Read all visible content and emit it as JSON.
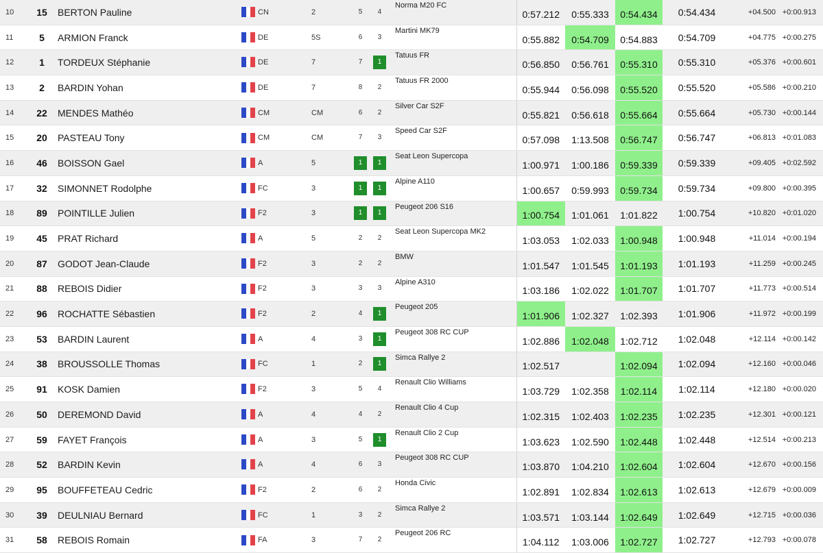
{
  "results": {
    "rows": [
      {
        "pos": "10",
        "num": "15",
        "name": "BERTON Pauline",
        "cls": "CN",
        "grp": "2",
        "rk1": "5",
        "rk2": "4",
        "rk2_top": false,
        "car": "Norma M20 FC",
        "t1": "0:57.212",
        "t2": "0:55.333",
        "t3": "0:54.434",
        "best_col": 3,
        "best": "0:54.434",
        "gap": "+04.500",
        "diff": "+0:00.913"
      },
      {
        "pos": "11",
        "num": "5",
        "name": "ARMION Franck",
        "cls": "DE",
        "grp": "5S",
        "rk1": "6",
        "rk2": "3",
        "rk2_top": false,
        "car": "Martini MK79",
        "t1": "0:55.882",
        "t2": "0:54.709",
        "t3": "0:54.883",
        "best_col": 2,
        "best": "0:54.709",
        "gap": "+04.775",
        "diff": "+0:00.275"
      },
      {
        "pos": "12",
        "num": "1",
        "name": "TORDEUX Stéphanie",
        "cls": "DE",
        "grp": "7",
        "rk1": "7",
        "rk2": "1",
        "rk2_top": true,
        "car": "Tatuus FR",
        "t1": "0:56.850",
        "t2": "0:56.761",
        "t3": "0:55.310",
        "best_col": 3,
        "best": "0:55.310",
        "gap": "+05.376",
        "diff": "+0:00.601"
      },
      {
        "pos": "13",
        "num": "2",
        "name": "BARDIN Yohan",
        "cls": "DE",
        "grp": "7",
        "rk1": "8",
        "rk2": "2",
        "rk2_top": false,
        "car": "Tatuus FR 2000",
        "t1": "0:55.944",
        "t2": "0:56.098",
        "t3": "0:55.520",
        "best_col": 3,
        "best": "0:55.520",
        "gap": "+05.586",
        "diff": "+0:00.210"
      },
      {
        "pos": "14",
        "num": "22",
        "name": "MENDES Mathéo",
        "cls": "CM",
        "grp": "CM",
        "rk1": "6",
        "rk2": "2",
        "rk2_top": false,
        "car": "Silver Car S2F",
        "t1": "0:55.821",
        "t2": "0:56.618",
        "t3": "0:55.664",
        "best_col": 3,
        "best": "0:55.664",
        "gap": "+05.730",
        "diff": "+0:00.144"
      },
      {
        "pos": "15",
        "num": "20",
        "name": "PASTEAU Tony",
        "cls": "CM",
        "grp": "CM",
        "rk1": "7",
        "rk2": "3",
        "rk2_top": false,
        "car": "Speed Car S2F",
        "t1": "0:57.098",
        "t2": "1:13.508",
        "t3": "0:56.747",
        "best_col": 3,
        "best": "0:56.747",
        "gap": "+06.813",
        "diff": "+0:01.083"
      },
      {
        "pos": "16",
        "num": "46",
        "name": "BOISSON Gael",
        "cls": "A",
        "grp": "5",
        "rk1": "1",
        "rk2": "1",
        "rk1_top": true,
        "rk2_top": true,
        "car": "Seat Leon Supercopa",
        "t1": "1:00.971",
        "t2": "1:00.186",
        "t3": "0:59.339",
        "best_col": 3,
        "best": "0:59.339",
        "gap": "+09.405",
        "diff": "+0:02.592"
      },
      {
        "pos": "17",
        "num": "32",
        "name": "SIMONNET Rodolphe",
        "cls": "FC",
        "grp": "3",
        "rk1": "1",
        "rk2": "1",
        "rk1_top": true,
        "rk2_top": true,
        "car": "Alpine A110",
        "t1": "1:00.657",
        "t2": "0:59.993",
        "t3": "0:59.734",
        "best_col": 3,
        "best": "0:59.734",
        "gap": "+09.800",
        "diff": "+0:00.395"
      },
      {
        "pos": "18",
        "num": "89",
        "name": "POINTILLE Julien",
        "cls": "F2",
        "grp": "3",
        "rk1": "1",
        "rk2": "1",
        "rk1_top": true,
        "rk2_top": true,
        "car": "Peugeot 206 S16",
        "t1": "1:00.754",
        "t2": "1:01.061",
        "t3": "1:01.822",
        "best_col": 1,
        "best": "1:00.754",
        "gap": "+10.820",
        "diff": "+0:01.020"
      },
      {
        "pos": "19",
        "num": "45",
        "name": "PRAT Richard",
        "cls": "A",
        "grp": "5",
        "rk1": "2",
        "rk2": "2",
        "rk2_top": false,
        "car": "Seat Leon Supercopa MK2",
        "t1": "1:03.053",
        "t2": "1:02.033",
        "t3": "1:00.948",
        "best_col": 3,
        "best": "1:00.948",
        "gap": "+11.014",
        "diff": "+0:00.194"
      },
      {
        "pos": "20",
        "num": "87",
        "name": "GODOT Jean-Claude",
        "cls": "F2",
        "grp": "3",
        "rk1": "2",
        "rk2": "2",
        "rk2_top": false,
        "car": "BMW",
        "t1": "1:01.547",
        "t2": "1:01.545",
        "t3": "1:01.193",
        "best_col": 3,
        "best": "1:01.193",
        "gap": "+11.259",
        "diff": "+0:00.245"
      },
      {
        "pos": "21",
        "num": "88",
        "name": "REBOIS Didier",
        "cls": "F2",
        "grp": "3",
        "rk1": "3",
        "rk2": "3",
        "rk2_top": false,
        "car": "Alpine A310",
        "t1": "1:03.186",
        "t2": "1:02.022",
        "t3": "1:01.707",
        "best_col": 3,
        "best": "1:01.707",
        "gap": "+11.773",
        "diff": "+0:00.514"
      },
      {
        "pos": "22",
        "num": "96",
        "name": "ROCHATTE Sébastien",
        "cls": "F2",
        "grp": "2",
        "rk1": "4",
        "rk2": "1",
        "rk2_top": true,
        "car": "Peugeot 205",
        "t1": "1:01.906",
        "t2": "1:02.327",
        "t3": "1:02.393",
        "best_col": 1,
        "best": "1:01.906",
        "gap": "+11.972",
        "diff": "+0:00.199"
      },
      {
        "pos": "23",
        "num": "53",
        "name": "BARDIN Laurent",
        "cls": "A",
        "grp": "4",
        "rk1": "3",
        "rk2": "1",
        "rk2_top": true,
        "car": "Peugeot 308 RC CUP",
        "t1": "1:02.886",
        "t2": "1:02.048",
        "t3": "1:02.712",
        "best_col": 2,
        "best": "1:02.048",
        "gap": "+12.114",
        "diff": "+0:00.142"
      },
      {
        "pos": "24",
        "num": "38",
        "name": "BROUSSOLLE Thomas",
        "cls": "FC",
        "grp": "1",
        "rk1": "2",
        "rk2": "1",
        "rk2_top": true,
        "car": "Simca Rallye 2",
        "t1": "1:02.517",
        "t2": "",
        "t3": "1:02.094",
        "best_col": 3,
        "best": "1:02.094",
        "gap": "+12.160",
        "diff": "+0:00.046"
      },
      {
        "pos": "25",
        "num": "91",
        "name": "KOSK Damien",
        "cls": "F2",
        "grp": "3",
        "rk1": "5",
        "rk2": "4",
        "rk2_top": false,
        "car": "Renault Clio Williams",
        "t1": "1:03.729",
        "t2": "1:02.358",
        "t3": "1:02.114",
        "best_col": 3,
        "best": "1:02.114",
        "gap": "+12.180",
        "diff": "+0:00.020"
      },
      {
        "pos": "26",
        "num": "50",
        "name": "DEREMOND David",
        "cls": "A",
        "grp": "4",
        "rk1": "4",
        "rk2": "2",
        "rk2_top": false,
        "car": "Renault Clio 4 Cup",
        "t1": "1:02.315",
        "t2": "1:02.403",
        "t3": "1:02.235",
        "best_col": 3,
        "best": "1:02.235",
        "gap": "+12.301",
        "diff": "+0:00.121"
      },
      {
        "pos": "27",
        "num": "59",
        "name": "FAYET François",
        "cls": "A",
        "grp": "3",
        "rk1": "5",
        "rk2": "1",
        "rk2_top": true,
        "car": "Renault Clio 2 Cup",
        "t1": "1:03.623",
        "t2": "1:02.590",
        "t3": "1:02.448",
        "best_col": 3,
        "best": "1:02.448",
        "gap": "+12.514",
        "diff": "+0:00.213"
      },
      {
        "pos": "28",
        "num": "52",
        "name": "BARDIN Kevin",
        "cls": "A",
        "grp": "4",
        "rk1": "6",
        "rk2": "3",
        "rk2_top": false,
        "car": "Peugeot 308 RC CUP",
        "t1": "1:03.870",
        "t2": "1:04.210",
        "t3": "1:02.604",
        "best_col": 3,
        "best": "1:02.604",
        "gap": "+12.670",
        "diff": "+0:00.156"
      },
      {
        "pos": "29",
        "num": "95",
        "name": "BOUFFETEAU Cedric",
        "cls": "F2",
        "grp": "2",
        "rk1": "6",
        "rk2": "2",
        "rk2_top": false,
        "car": "Honda Civic",
        "t1": "1:02.891",
        "t2": "1:02.834",
        "t3": "1:02.613",
        "best_col": 3,
        "best": "1:02.613",
        "gap": "+12.679",
        "diff": "+0:00.009"
      },
      {
        "pos": "30",
        "num": "39",
        "name": "DEULNIAU Bernard",
        "cls": "FC",
        "grp": "1",
        "rk1": "3",
        "rk2": "2",
        "rk2_top": false,
        "car": "Simca Rallye 2",
        "t1": "1:03.571",
        "t2": "1:03.144",
        "t3": "1:02.649",
        "best_col": 3,
        "best": "1:02.649",
        "gap": "+12.715",
        "diff": "+0:00.036"
      },
      {
        "pos": "31",
        "num": "58",
        "name": "REBOIS Romain",
        "cls": "FA",
        "grp": "3",
        "rk1": "7",
        "rk2": "2",
        "rk2_top": false,
        "car": "Peugeot 206 RC",
        "t1": "1:04.112",
        "t2": "1:03.006",
        "t3": "1:02.727",
        "best_col": 3,
        "best": "1:02.727",
        "gap": "+12.793",
        "diff": "+0:00.078"
      }
    ]
  },
  "colors": {
    "row_alt": "#efefef",
    "best_time_highlight": "#8ff08b",
    "rank_top": "#1f8e2b",
    "flag_blue": "#2c49c6",
    "flag_red": "#e2434b"
  },
  "icons": {
    "flag": "france-flag-icon"
  }
}
